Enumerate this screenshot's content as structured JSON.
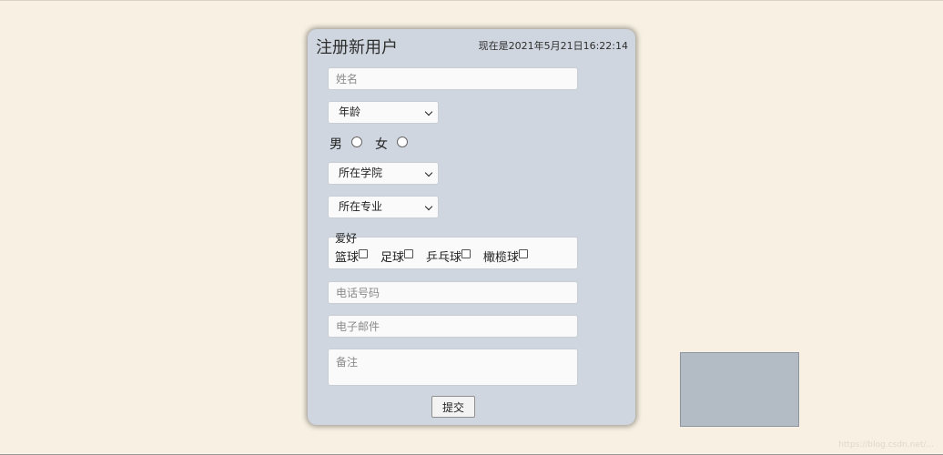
{
  "form": {
    "title": "注册新用户",
    "time_prefix": "现在是",
    "time_value": "2021年5月21日16:22:14",
    "name_placeholder": "姓名",
    "age_select": "年龄",
    "gender": {
      "male": "男",
      "female": "女"
    },
    "college_select": "所在学院",
    "major_select": "所在专业",
    "hobby_legend": "爱好",
    "hobbies": [
      "篮球",
      "足球",
      "乒乓球",
      "橄榄球"
    ],
    "phone_placeholder": "电话号码",
    "email_placeholder": "电子邮件",
    "note_placeholder": "备注",
    "submit_label": "提交"
  },
  "watermark": "https://blog.csdn.net/..."
}
